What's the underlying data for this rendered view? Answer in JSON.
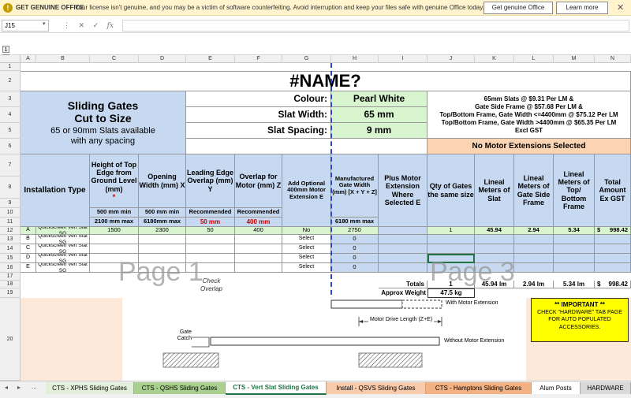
{
  "notification": {
    "title": "GET GENUINE OFFICE",
    "message": "Your license isn't genuine, and you may be a victim of software counterfeiting. Avoid interruption and keep your files safe with genuine Office today.",
    "primary_button": "Get genuine Office",
    "secondary_button": "Learn more"
  },
  "formula_bar": {
    "name_box": "J15",
    "fx_label": "fx",
    "value": ""
  },
  "columns": [
    "A",
    "B",
    "C",
    "D",
    "E",
    "F",
    "G",
    "H",
    "I",
    "J",
    "K",
    "L",
    "M",
    "N"
  ],
  "rows": [
    "1",
    "2",
    "3",
    "4",
    "5",
    "6",
    "7",
    "8",
    "9",
    "10",
    "11",
    "12",
    "13",
    "14",
    "15",
    "16",
    "17",
    "18",
    "19",
    "20"
  ],
  "outline": {
    "level1": "1",
    "level2": "2",
    "zero_marker": "0"
  },
  "sheet": {
    "name_error": "#NAME?",
    "title1": "Sliding Gates",
    "title2": "Cut to Size",
    "title3": "65 or 90mm Slats available",
    "title4": "with any spacing",
    "colour_label": "Colour:",
    "colour_value": "Pearl White",
    "slat_width_label": "Slat Width:",
    "slat_width_value": "65 mm",
    "slat_spacing_label": "Slat Spacing:",
    "slat_spacing_value": "9 mm",
    "pricing": [
      "65mm Slats @ $9.31 Per LM &",
      "Gate Side Frame @ $57.68 Per LM &",
      "Top/Bottom Frame, Gate Width <=4400mm @ $75.12 Per LM",
      "Top/Bottom Frame, Gate Width >4400mm @ $65.35 Per LM",
      "Excl GST"
    ],
    "motor_status": "No Motor Extensions Selected",
    "headers": {
      "install_type": "Installation Type",
      "height": "Height of Top Edge from Ground Level (mm)",
      "height_mark": "*",
      "opening": "Opening Width (mm) X",
      "leading": "Leading Edge Overlap (mm) Y",
      "overlap": "Overlap for Motor (mm) Z",
      "add_optional": "Add Optional 400mm Motor Extension E",
      "manufactured": "Manufactured Gate Width (mm) [X + Y + Z]",
      "plus_motor": "Plus Motor Extension Where Selected E",
      "qty": "Qty of Gates the same size",
      "lm_slat": "Lineal Meters of Slat",
      "lm_side": "Lineal Meters of Gate Side Frame",
      "lm_top": "Lineal Meters of Top/ Bottom Frame",
      "total": "Total Amount Ex GST"
    },
    "limits": {
      "height_min": "500 mm min",
      "height_max": "2100 mm max",
      "opening_min": "500 mm min",
      "opening_max": "6180mm max",
      "leading_rec": "Recommended",
      "leading_val": "50 mm",
      "overlap_rec": "Recommended",
      "overlap_val": "400 mm",
      "manufactured_max": "6180 mm max"
    },
    "data_rows": [
      {
        "letter": "A",
        "type": "Quickscreen Vert Slat SG",
        "height": "1500",
        "opening": "2300",
        "leading": "50",
        "overlap": "400",
        "motor": "No",
        "width": "2750",
        "qty": "1",
        "slat": "45.94",
        "side": "2.94",
        "top": "5.34",
        "currency": "$",
        "total": "998.42"
      },
      {
        "letter": "B",
        "type": "Quickscreen Vert Slat SG",
        "height": "",
        "opening": "",
        "leading": "",
        "overlap": "",
        "motor": "Select",
        "width": "0",
        "qty": "",
        "slat": "",
        "side": "",
        "top": "",
        "currency": "",
        "total": ""
      },
      {
        "letter": "C",
        "type": "Quickscreen Vert Slat SG",
        "height": "",
        "opening": "",
        "leading": "",
        "overlap": "",
        "motor": "Select",
        "width": "0",
        "qty": "",
        "slat": "",
        "side": "",
        "top": "",
        "currency": "",
        "total": ""
      },
      {
        "letter": "D",
        "type": "Quickscreen Vert Slat SG",
        "height": "",
        "opening": "",
        "leading": "",
        "overlap": "",
        "motor": "Select",
        "width": "0",
        "qty": "",
        "slat": "",
        "side": "",
        "top": "",
        "currency": "",
        "total": ""
      },
      {
        "letter": "E",
        "type": "Quickscreen Vert Slat SG",
        "height": "",
        "opening": "",
        "leading": "",
        "overlap": "",
        "motor": "Select",
        "width": "0",
        "qty": "",
        "slat": "",
        "side": "",
        "top": "",
        "currency": "",
        "total": ""
      }
    ],
    "totals": {
      "label": "Totals",
      "qty": "1",
      "slat": "45.94 lm",
      "side": "2.94 lm",
      "top": "5.34 lm",
      "currency": "$",
      "total": "998.42"
    },
    "approx_weight_label": "Approx Weight",
    "approx_weight_value": "47.5 kg",
    "page1": "Page 1",
    "page3": "Page 3",
    "check_overlap": "Check Overlap",
    "diagram": {
      "with_motor": "With Motor Extension",
      "motor_drive": "Motor Drive Length (Z+E)",
      "gate_catch": "Gate Catch",
      "without_motor": "Without Motor Extension"
    },
    "important": [
      "** IMPORTANT **",
      "CHECK \"HARDWARE\" TAB PAGE",
      "FOR AUTO POPULATED",
      "ACCESSORIES."
    ]
  },
  "tabs": [
    {
      "label": "CTS - XPHS Sliding Gates",
      "color": "#e2efda"
    },
    {
      "label": "CTS - QSHS Sliding Gates",
      "color": "#a9d08e"
    },
    {
      "label": "CTS - Vert Slat Sliding Gates",
      "color": "#ffffff"
    },
    {
      "label": "Install - QSVS Sliding Gates",
      "color": "#f8cbad"
    },
    {
      "label": "CTS - Hamptons Sliding Gates",
      "color": "#f4b183"
    },
    {
      "label": "Alum Posts",
      "color": "#ffffff"
    },
    {
      "label": "HARDWARE",
      "color": "#d9d9d9"
    }
  ]
}
